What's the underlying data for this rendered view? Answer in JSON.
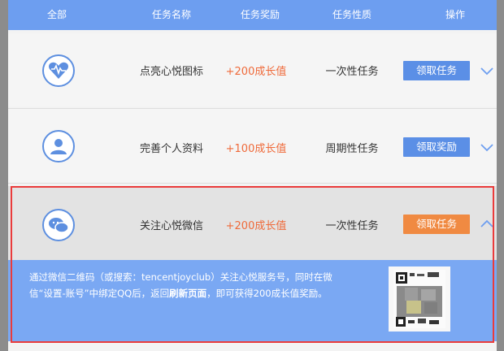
{
  "table": {
    "headers": [
      "全部",
      "任务名称",
      "任务奖励",
      "任务性质",
      "操作"
    ]
  },
  "tasks": [
    {
      "name": "点亮心悦图标",
      "reward": "+200成长值",
      "type": "一次性任务",
      "action": "领取任务",
      "icon": "heart-pulse-icon",
      "expanded": false
    },
    {
      "name": "完善个人资料",
      "reward": "+100成长值",
      "type": "周期性任务",
      "action": "领取奖励",
      "icon": "user-profile-icon",
      "expanded": false
    },
    {
      "name": "关注心悦微信",
      "reward": "+200成长值",
      "type": "一次性任务",
      "action": "领取任务",
      "icon": "wechat-icon",
      "expanded": true
    }
  ],
  "detail": {
    "line1": "通过微信二维码（或搜索：tencentjoyclub）关注心悦服务号，同时在微",
    "line2_a": "信“设置-账号”中绑定QQ后，返回",
    "line2_b": "刷新页面",
    "line2_c": "，即可获得200成长值奖励。",
    "qr_icon": "qr-code-icon"
  },
  "colors": {
    "header_bg": "#6d9ef0",
    "accent_blue": "#5b8fe6",
    "accent_orange": "#f08a42",
    "reward_text": "#ef6a3a",
    "highlight_border": "#ea3b3b",
    "detail_bg": "#7aa8f3"
  }
}
